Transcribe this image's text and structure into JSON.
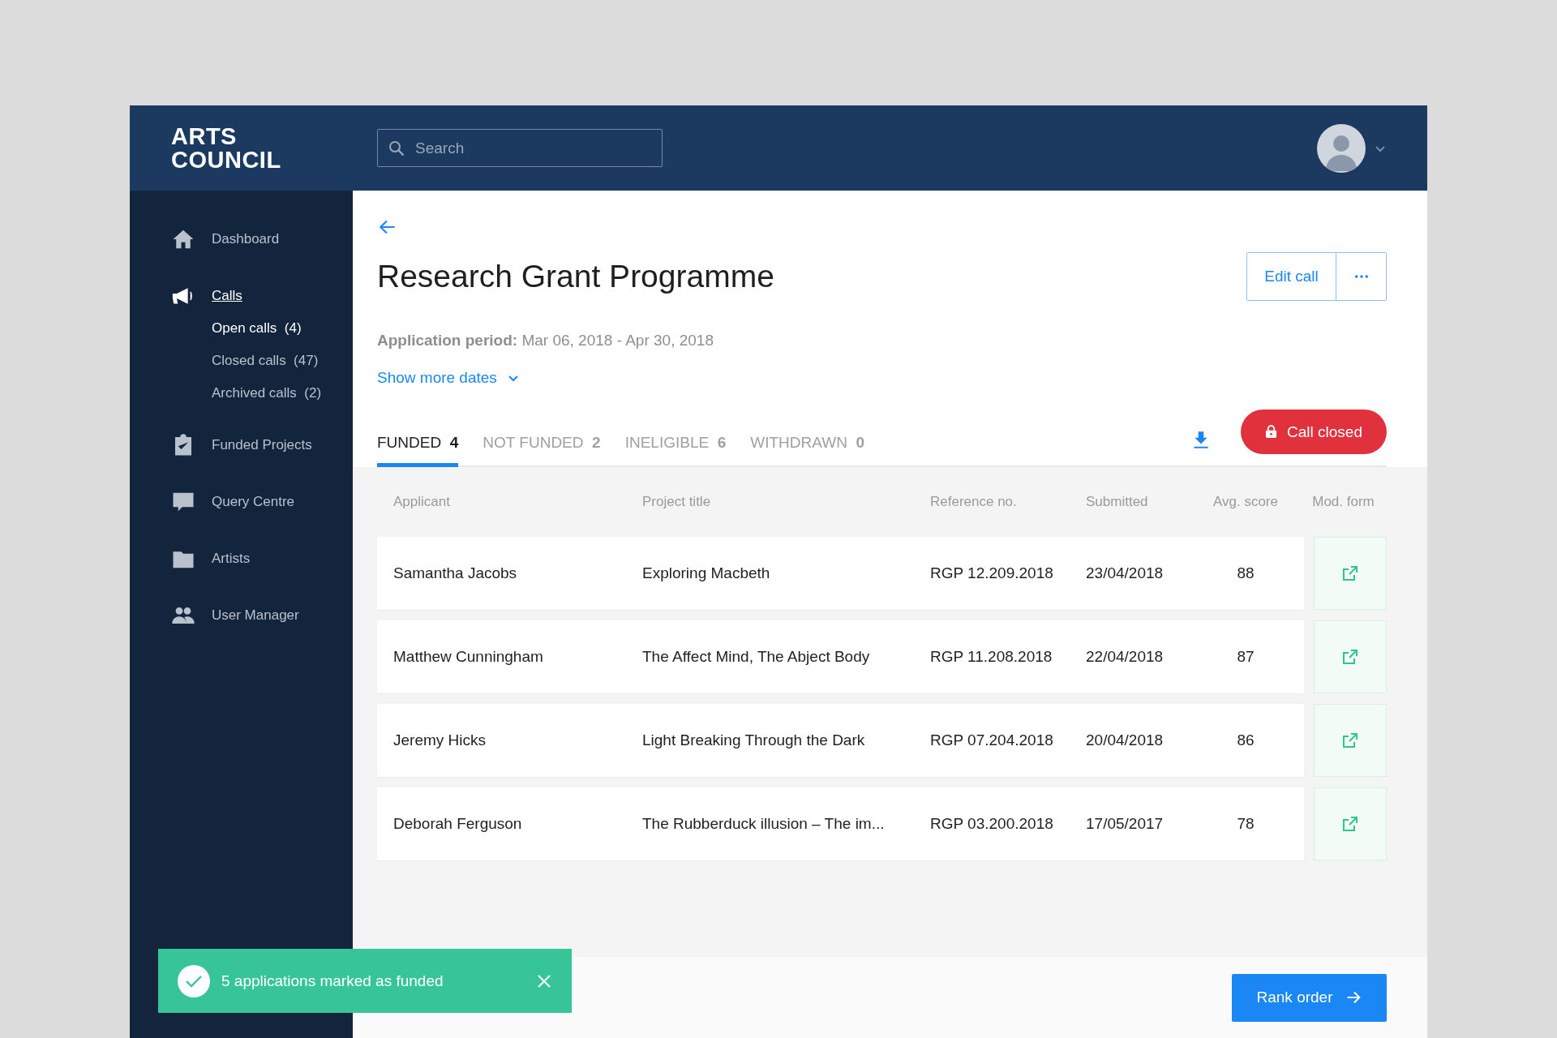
{
  "header": {
    "logo": [
      "ARTS",
      "COUNCIL"
    ],
    "search": {
      "placeholder": "Search"
    }
  },
  "sidebar": {
    "items": [
      {
        "label": "Dashboard",
        "selected": false
      },
      {
        "label": "Calls",
        "selected": true,
        "children": [
          {
            "label": "Open calls",
            "count": "(4)",
            "selected": true
          },
          {
            "label": "Closed calls",
            "count": "(47)",
            "selected": false
          },
          {
            "label": "Archived calls",
            "count": "(2)",
            "selected": false
          }
        ]
      },
      {
        "label": "Funded Projects",
        "selected": false
      },
      {
        "label": "Query Centre",
        "selected": false
      },
      {
        "label": "Artists",
        "selected": false
      },
      {
        "label": "User Manager",
        "selected": false
      }
    ]
  },
  "page": {
    "title": "Research Grant Programme",
    "period": "**Application period:** Mar 06, 2018 - Apr 30, 2018",
    "show_more": "Show more dates",
    "edit_button": "Edit call",
    "status": "Call closed"
  },
  "tabs": [
    {
      "label": "FUNDED",
      "count": "4",
      "selected": true
    },
    {
      "label": "NOT FUNDED",
      "count": "2",
      "selected": false
    },
    {
      "label": "INELIGIBLE",
      "count": "6",
      "selected": false
    },
    {
      "label": "WITHDRAWN",
      "count": "0",
      "selected": false
    }
  ],
  "table": {
    "columns": [
      "Applicant",
      "Project title",
      "Reference no.",
      "Submitted",
      "Avg. score",
      "Mod. form"
    ],
    "rows": [
      [
        "Samantha Jacobs",
        "Exploring Macbeth",
        "RGP 12.209.2018",
        "23/04/2018",
        "88"
      ],
      [
        "Matthew Cunningham",
        "The Affect Mind, The Abject Body",
        "RGP 11.208.2018",
        "22/04/2018",
        "87"
      ],
      [
        "Jeremy Hicks",
        "Light Breaking Through the Dark",
        "RGP 07.204.2018",
        "20/04/2018",
        "86"
      ],
      [
        "Deborah Ferguson",
        "The Rubberduck illusion – The im...",
        "RGP 03.200.2018",
        "17/05/2017",
        "78"
      ]
    ]
  },
  "toast": {
    "text": "5 applications marked as funded"
  },
  "footer": {
    "button": "Rank order"
  }
}
